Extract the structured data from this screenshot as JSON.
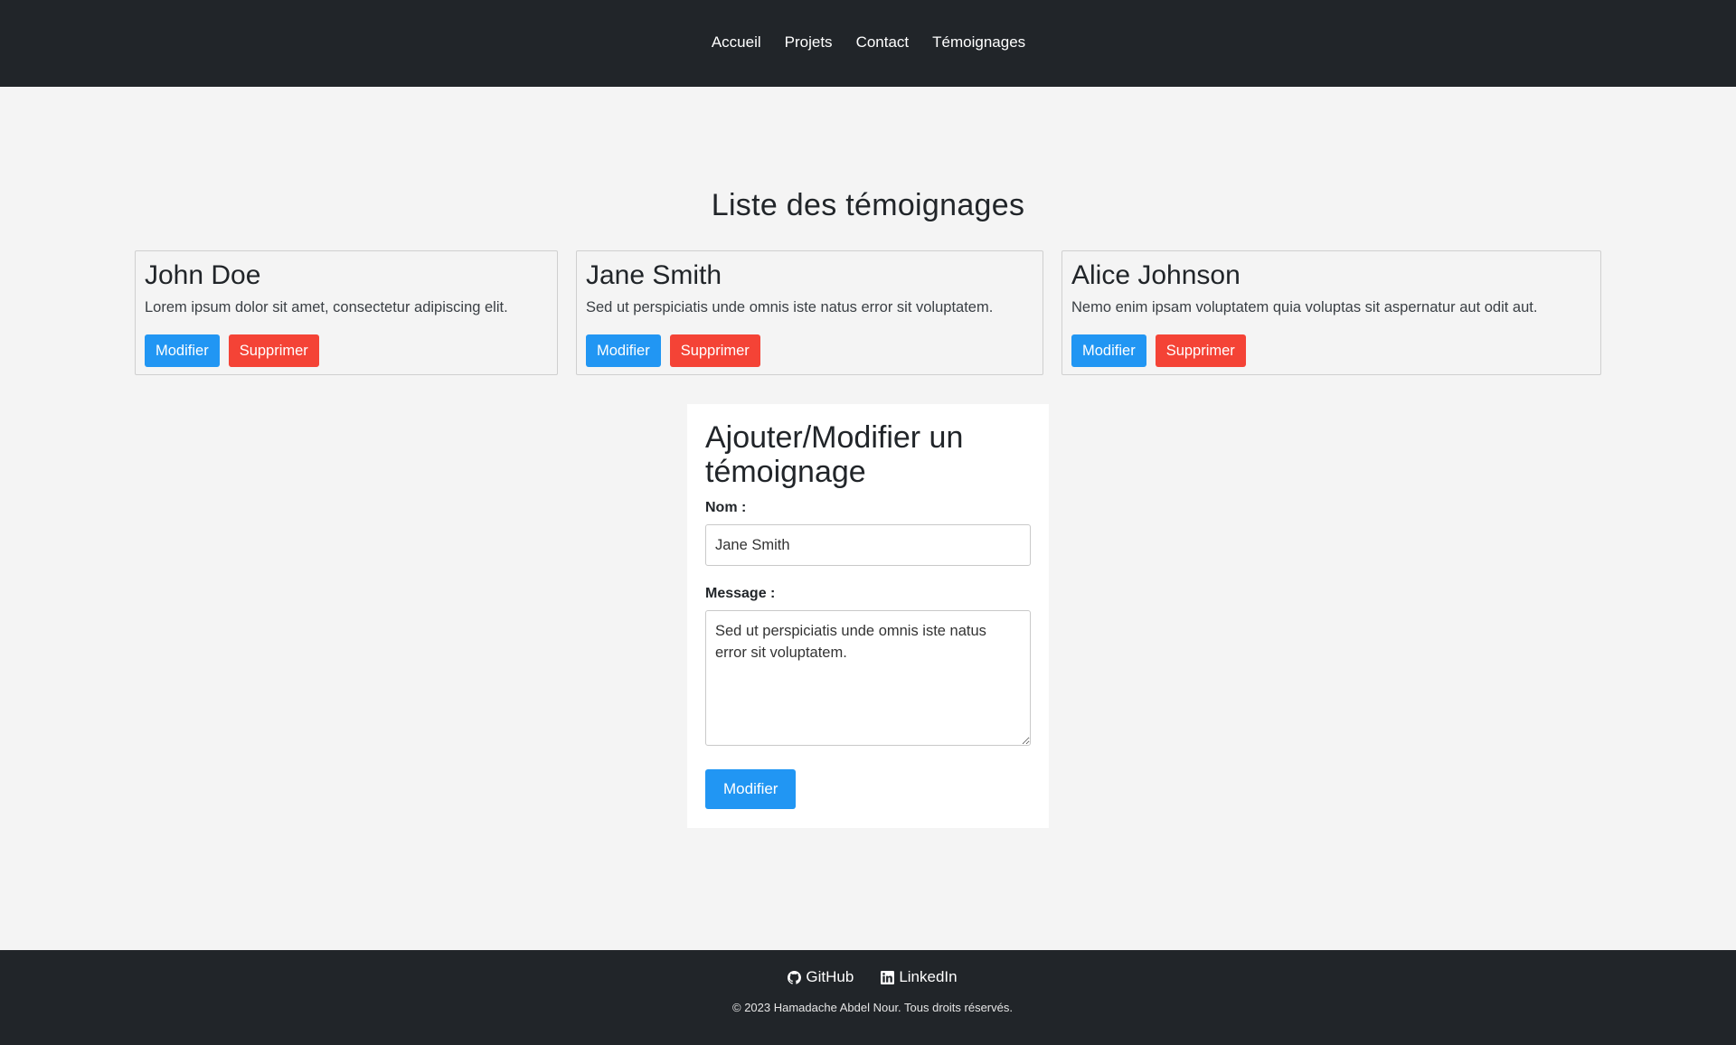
{
  "nav": {
    "items": [
      {
        "label": "Accueil"
      },
      {
        "label": "Projets"
      },
      {
        "label": "Contact"
      },
      {
        "label": "Témoignages"
      }
    ]
  },
  "main": {
    "title": "Liste des témoignages",
    "testimonials": [
      {
        "name": "John Doe",
        "message": "Lorem ipsum dolor sit amet, consectetur adipiscing elit.",
        "edit_label": "Modifier",
        "delete_label": "Supprimer"
      },
      {
        "name": "Jane Smith",
        "message": "Sed ut perspiciatis unde omnis iste natus error sit voluptatem.",
        "edit_label": "Modifier",
        "delete_label": "Supprimer"
      },
      {
        "name": "Alice Johnson",
        "message": "Nemo enim ipsam voluptatem quia voluptas sit aspernatur aut odit aut.",
        "edit_label": "Modifier",
        "delete_label": "Supprimer"
      }
    ]
  },
  "form": {
    "title": "Ajouter/Modifier un témoignage",
    "name_label": "Nom :",
    "name_value": "Jane Smith",
    "message_label": "Message :",
    "message_value": "Sed ut perspiciatis unde omnis iste natus error sit voluptatem.",
    "submit_label": "Modifier"
  },
  "footer": {
    "links": [
      {
        "label": "GitHub",
        "icon": "github-icon"
      },
      {
        "label": "LinkedIn",
        "icon": "linkedin-icon"
      }
    ],
    "copyright": "© 2023 Hamadache Abdel Nour. Tous droits réservés."
  },
  "colors": {
    "header_bg": "#212529",
    "page_bg": "#f4f4f4",
    "primary_button": "#2196f3",
    "danger_button": "#f44336"
  }
}
